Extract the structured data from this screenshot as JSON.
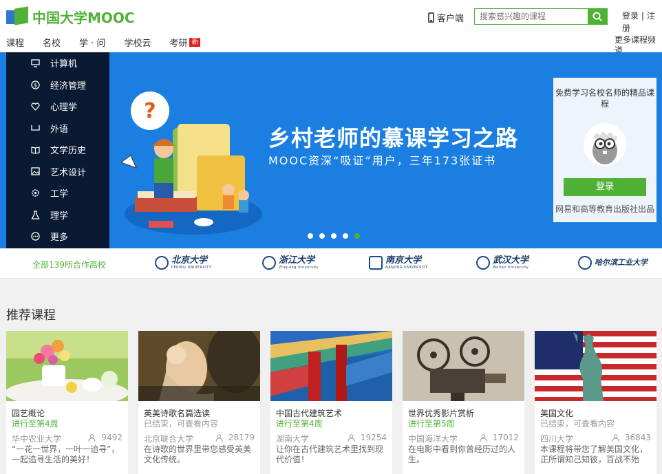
{
  "header": {
    "logo_text": "中国大学MOOC",
    "client_label": "客户端",
    "search_placeholder": "搜索感兴趣的课程",
    "login_register": "登录 | 注册",
    "more_channels": "更多课程频道"
  },
  "nav": [
    {
      "label": "课程"
    },
    {
      "label": "名校"
    },
    {
      "label": "学 · 问"
    },
    {
      "label": "学校云"
    },
    {
      "label": "考研",
      "badge": "新"
    }
  ],
  "categories": [
    {
      "label": "计算机",
      "icon": "monitor-icon"
    },
    {
      "label": "经济管理",
      "icon": "coin-icon"
    },
    {
      "label": "心理学",
      "icon": "heart-icon"
    },
    {
      "label": "外语",
      "icon": "chat-bubble-icon"
    },
    {
      "label": "文学历史",
      "icon": "book-icon"
    },
    {
      "label": "艺术设计",
      "icon": "picture-icon"
    },
    {
      "label": "工学",
      "icon": "gear-icon"
    },
    {
      "label": "理学",
      "icon": "flask-icon"
    },
    {
      "label": "更多",
      "icon": "more-icon"
    }
  ],
  "banner": {
    "title": "乡村老师的慕课学习之路",
    "subtitle": "MOOC资深“吸证”用户，三年173张证书",
    "slide_count": 5,
    "active_slide": 5
  },
  "login_panel": {
    "tagline": "免费学习名校名师的精品课程",
    "login_button": "登录",
    "footer": "网易和高等教育出版社出品"
  },
  "partners": {
    "all_label": "全部139所合作高校",
    "universities": [
      {
        "cn": "北京大学",
        "en": "PEKING UNIVERSITY"
      },
      {
        "cn": "浙江大学",
        "en": "Zhejiang University"
      },
      {
        "cn": "南京大学",
        "en": "NANJING UNIVERSITY"
      },
      {
        "cn": "武汉大学",
        "en": "Wuhan University"
      },
      {
        "cn": "哈尔滨工业大学",
        "en": ""
      }
    ]
  },
  "section_title": "推荐课程",
  "courses": [
    {
      "name": "园艺概论",
      "status": "进行至第4周",
      "status_type": "ongoing",
      "school": "华中农业大学",
      "count": "9492",
      "desc": "“一花一世界，一叶一追寻”，一起追寻生活的美好！"
    },
    {
      "name": "英美诗歌名篇选读",
      "status": "已结束，可查看内容",
      "status_type": "ended",
      "school": "北京联合大学",
      "count": "28179",
      "desc": "在诗歌的世界里带您感受英美文化传统。"
    },
    {
      "name": "中国古代建筑艺术",
      "status": "进行至第4周",
      "status_type": "ongoing",
      "school": "湖南大学",
      "count": "19254",
      "desc": "让你在古代建筑艺术里找到现代价值！"
    },
    {
      "name": "世界优秀影片赏析",
      "status": "进行至第5周",
      "status_type": "ongoing",
      "school": "中国海洋大学",
      "count": "17012",
      "desc": "在电影中看到你曾经历过的人生。"
    },
    {
      "name": "美国文化",
      "status": "已结束，可查看内容",
      "status_type": "ended",
      "school": "四川大学",
      "count": "36843",
      "desc": "本课程将带您了解美国文化，正所谓知己知彼，百战不殆"
    }
  ],
  "colors": {
    "brand_green": "#4fb237",
    "banner_blue": "#1a7fe0",
    "menu_dark": "#0a1a33"
  }
}
